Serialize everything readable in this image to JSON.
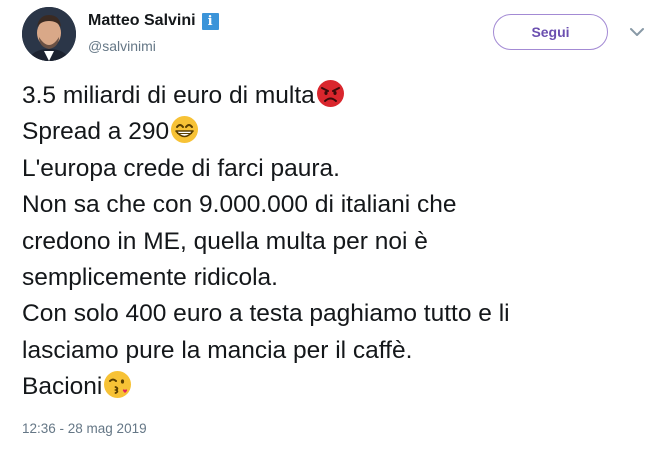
{
  "author": {
    "display_name": "Matteo Salvini",
    "verified_icon": "verified-badge-icon",
    "handle": "@salvinimi",
    "avatar_icon": "profile-photo"
  },
  "actions": {
    "follow_label": "Segui",
    "more_icon": "chevron-down-icon"
  },
  "tweet": {
    "lines": [
      {
        "text": "3.5 miliardi di euro di multa",
        "emoji": "angry-face-emoji"
      },
      {
        "text": "Spread a 290",
        "emoji": "grinning-face-emoji"
      },
      {
        "text": "L'europa crede di farci paura.",
        "emoji": ""
      },
      {
        "text": "Non sa che con 9.000.000 di italiani che",
        "emoji": ""
      },
      {
        "text": "credono in ME, quella multa per noi è",
        "emoji": ""
      },
      {
        "text": "semplicemente ridicola.",
        "emoji": ""
      },
      {
        "text": "Con solo 400 euro a testa paghiamo tutto e li",
        "emoji": ""
      },
      {
        "text": "lasciamo pure la mancia per il caffè.",
        "emoji": ""
      },
      {
        "text": "Bacioni",
        "emoji": "kissing-wink-face-emoji"
      }
    ]
  },
  "timestamp": "12:36 - 28 mag 2019",
  "colors": {
    "text": "#14171a",
    "secondary": "#657786",
    "verified": "#3b94d9",
    "follow_border": "#a38ad4",
    "follow_text": "#6b4fb0",
    "angry_emoji": "#d9262d",
    "smile_emoji": "#f7c236"
  }
}
